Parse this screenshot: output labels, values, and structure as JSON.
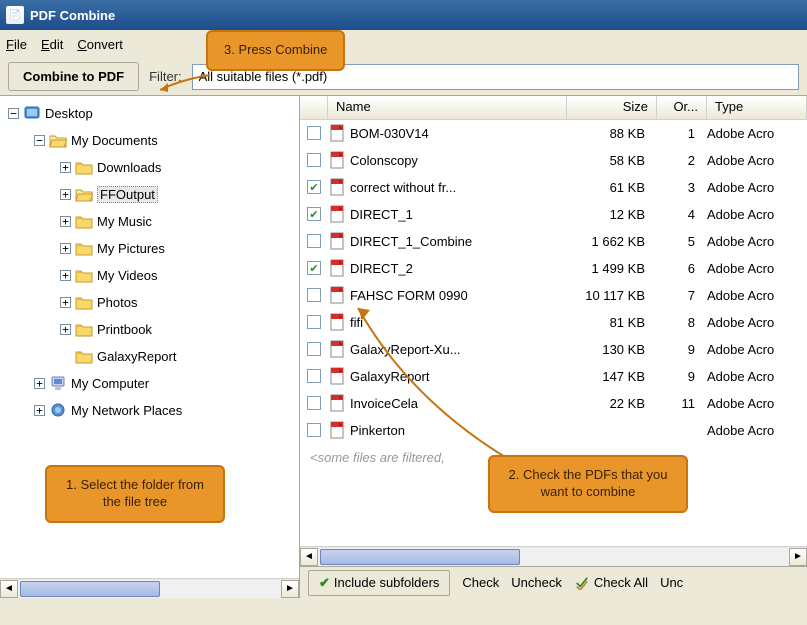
{
  "window": {
    "title": "PDF Combine"
  },
  "menu": {
    "file": "File",
    "edit": "Edit",
    "convert": "Convert"
  },
  "toolbar": {
    "combine": "Combine to PDF",
    "filter_label": "Filter:",
    "filter_value": "All suitable files (*.pdf)"
  },
  "tree": {
    "desktop": "Desktop",
    "mydocs": "My Documents",
    "downloads": "Downloads",
    "ffoutput": "FFOutput",
    "mymusic": "My Music",
    "mypictures": "My Pictures",
    "myvideos": "My Videos",
    "photos": "Photos",
    "printbook": "Printbook",
    "galaxyreport": "GalaxyReport",
    "mycomputer": "My Computer",
    "mynetwork": "My Network Places"
  },
  "columns": {
    "name": "Name",
    "size": "Size",
    "ord": "Or...",
    "type": "Type"
  },
  "files": [
    {
      "checked": false,
      "name": "BOM-030V14",
      "size": "88 KB",
      "ord": "1",
      "type": "Adobe Acro"
    },
    {
      "checked": false,
      "name": "Colonscopy",
      "size": "58 KB",
      "ord": "2",
      "type": "Adobe Acro"
    },
    {
      "checked": true,
      "name": "correct without fr...",
      "size": "61 KB",
      "ord": "3",
      "type": "Adobe Acro"
    },
    {
      "checked": true,
      "name": "DIRECT_1",
      "size": "12 KB",
      "ord": "4",
      "type": "Adobe Acro"
    },
    {
      "checked": false,
      "name": "DIRECT_1_Combine",
      "size": "1 662 KB",
      "ord": "5",
      "type": "Adobe Acro"
    },
    {
      "checked": true,
      "name": "DIRECT_2",
      "size": "1 499 KB",
      "ord": "6",
      "type": "Adobe Acro"
    },
    {
      "checked": false,
      "name": "FAHSC FORM 0990",
      "size": "10 117 KB",
      "ord": "7",
      "type": "Adobe Acro"
    },
    {
      "checked": false,
      "name": "fifi",
      "size": "81 KB",
      "ord": "8",
      "type": "Adobe Acro"
    },
    {
      "checked": false,
      "name": "GalaxyReport-Xu...",
      "size": "130 KB",
      "ord": "9",
      "type": "Adobe Acro"
    },
    {
      "checked": false,
      "name": "GalaxyReport",
      "size": "147 KB",
      "ord": "9",
      "type": "Adobe Acro"
    },
    {
      "checked": false,
      "name": "InvoiceCela",
      "size": "22 KB",
      "ord": "11",
      "type": "Adobe Acro"
    },
    {
      "checked": false,
      "name": "Pinkerton",
      "size": "",
      "ord": "",
      "type": "Adobe Acro"
    }
  ],
  "filtered_msg": "<some files are filtered,",
  "bottom": {
    "include": "Include subfolders",
    "check": "Check",
    "uncheck": "Uncheck",
    "checkall": "Check All",
    "unc": "Unc"
  },
  "callouts": {
    "c1": "1. Select the folder from the file tree",
    "c2": "2. Check the PDFs that you want to combine",
    "c3": "3. Press Combine"
  }
}
